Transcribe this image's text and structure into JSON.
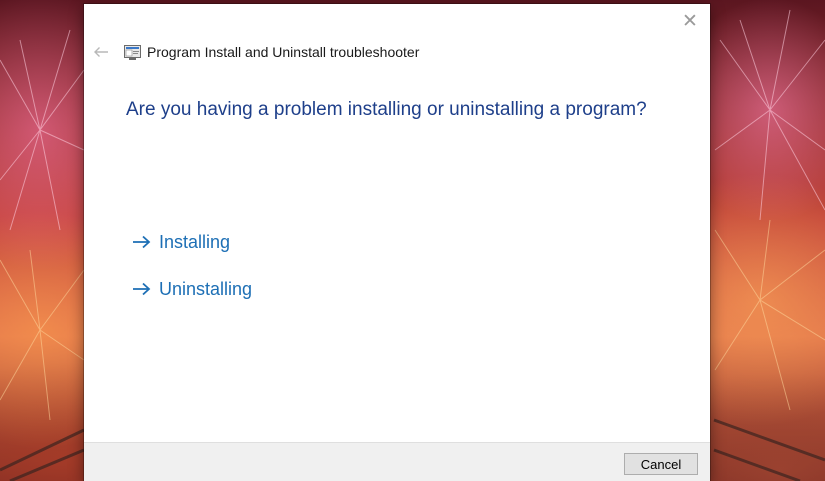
{
  "window": {
    "title": "Program Install and Uninstall troubleshooter",
    "close_glyph": "✕",
    "icons": {
      "back": "back-arrow-icon",
      "app": "troubleshooter-app-icon",
      "close": "close-icon"
    }
  },
  "main": {
    "heading": "Are you having a problem installing or uninstalling a program?",
    "choices": [
      {
        "label": "Installing",
        "icon": "arrow-right-icon"
      },
      {
        "label": "Uninstalling",
        "icon": "arrow-right-icon"
      }
    ]
  },
  "footer": {
    "cancel_label": "Cancel"
  },
  "colors": {
    "heading": "#1e3f8a",
    "link": "#1d6fb5",
    "footer_bg": "#f0f0f0",
    "window_bg": "#ffffff"
  }
}
